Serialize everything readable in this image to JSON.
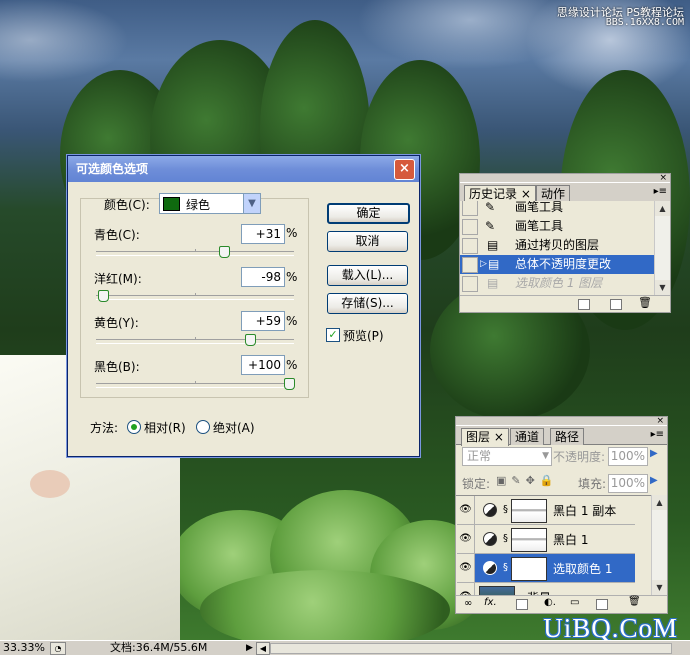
{
  "watermark": {
    "top_line1": "思缘设计论坛  PS教程论坛",
    "top_line2": "BBS.16XX8.COM",
    "bottom": "UiBQ.CoM"
  },
  "dialog": {
    "title": "可选颜色选项",
    "color_label": "颜色(C):",
    "color_value": "绿色",
    "swatch_color": "#0f6a0f",
    "sliders": [
      {
        "label": "青色(C):",
        "value": "+31",
        "unit": "%",
        "level": 0.655
      },
      {
        "label": "洋红(M):",
        "value": "-98",
        "unit": "%",
        "level": 0.01
      },
      {
        "label": "黄色(Y):",
        "value": "+59",
        "unit": "%",
        "level": 0.795
      },
      {
        "label": "黑色(B):",
        "value": "+100",
        "unit": "%",
        "level": 1.0
      }
    ],
    "buttons": {
      "ok": "确定",
      "cancel": "取消",
      "load": "载入(L)...",
      "save": "存储(S)..."
    },
    "preview_label": "预览(P)",
    "preview_checked": true,
    "method_label": "方法:",
    "method_relative": "相对(R)",
    "method_absolute": "绝对(A)",
    "method_selected": "relative"
  },
  "history": {
    "tabs": [
      "历史记录 ×",
      "动作"
    ],
    "items": [
      {
        "label": "画笔工具",
        "icon": "brush-icon"
      },
      {
        "label": "画笔工具",
        "icon": "brush-icon"
      },
      {
        "label": "通过拷贝的图层",
        "icon": "document-icon"
      },
      {
        "label": "总体不透明度更改",
        "icon": "document-icon",
        "selected": true
      },
      {
        "label": "选取颜色 1 图层",
        "icon": "document-icon",
        "dimmed": true
      }
    ]
  },
  "layers": {
    "tabs": [
      "图层 ×",
      "通道",
      "路径"
    ],
    "blend_mode": "正常",
    "opacity_label": "不透明度:",
    "opacity_value": "100%",
    "lock_label": "锁定:",
    "fill_label": "填充:",
    "fill_value": "100%",
    "rows": [
      {
        "name": "黑白 1 副本",
        "selected": false
      },
      {
        "name": "黑白 1",
        "selected": false
      },
      {
        "name": "选取颜色 1",
        "selected": true
      },
      {
        "name": "背景",
        "selected": false
      }
    ]
  },
  "status": {
    "zoom": "33.33%",
    "doc": "文档:36.4M/55.6M"
  }
}
